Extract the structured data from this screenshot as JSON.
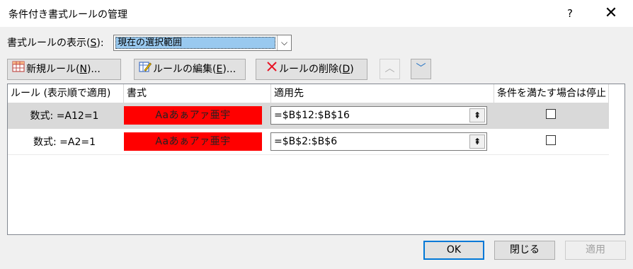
{
  "window": {
    "title": "条件付き書式ルールの管理",
    "help": "?",
    "close": "✕"
  },
  "scope": {
    "label_prefix": "書式ルールの表示(",
    "label_key": "S",
    "label_suffix": "):",
    "value": "現在の選択範囲",
    "arrow": "⌵"
  },
  "toolbar": {
    "new_rule_prefix": "新規ルール(",
    "new_rule_key": "N",
    "new_rule_suffix": ")...",
    "edit_rule_prefix": "ルールの編集(",
    "edit_rule_key": "E",
    "edit_rule_suffix": ")...",
    "delete_rule_prefix": "ルールの削除(",
    "delete_rule_key": "D",
    "delete_rule_suffix": ")",
    "move_up": "︿",
    "move_down": "﹀"
  },
  "table": {
    "headers": [
      "ルール (表示順で適用)",
      "書式",
      "適用先",
      "条件を満たす場合は停止"
    ],
    "rows": [
      {
        "rule": "数式: =A12=1",
        "preview": "Aaあぁアァ亜宇",
        "range": "=$B$12:$B$16",
        "stop": false,
        "selected": true
      },
      {
        "rule": "数式: =A2=1",
        "preview": "Aaあぁアァ亜宇",
        "range": "=$B$2:$B$6",
        "stop": false,
        "selected": false
      }
    ],
    "range_button": "⇞"
  },
  "buttons": {
    "ok": "OK",
    "close": "閉じる",
    "apply": "適用"
  },
  "colors": {
    "preview_fill": "#ff0000",
    "selection_highlight": "#99c9ef",
    "ok_border": "#0078d7"
  }
}
